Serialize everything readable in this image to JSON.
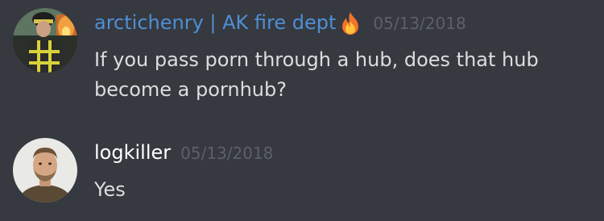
{
  "colors": {
    "background": "#36393f",
    "username_1": "#4e8fd6",
    "username_2": "#ffffff",
    "message_text": "#dcddde",
    "timestamp": "#5c6068"
  },
  "messages": [
    {
      "username": "arctichenry | AK fire dept",
      "badge_icon": "fire-emoji-icon",
      "timestamp": "05/13/2018",
      "text": "If you pass porn through a hub, does that hub become a pornhub?",
      "avatar": "firefighter-avatar"
    },
    {
      "username": "logkiller",
      "timestamp": "05/13/2018",
      "text": "Yes",
      "avatar": "bearded-man-avatar"
    }
  ]
}
